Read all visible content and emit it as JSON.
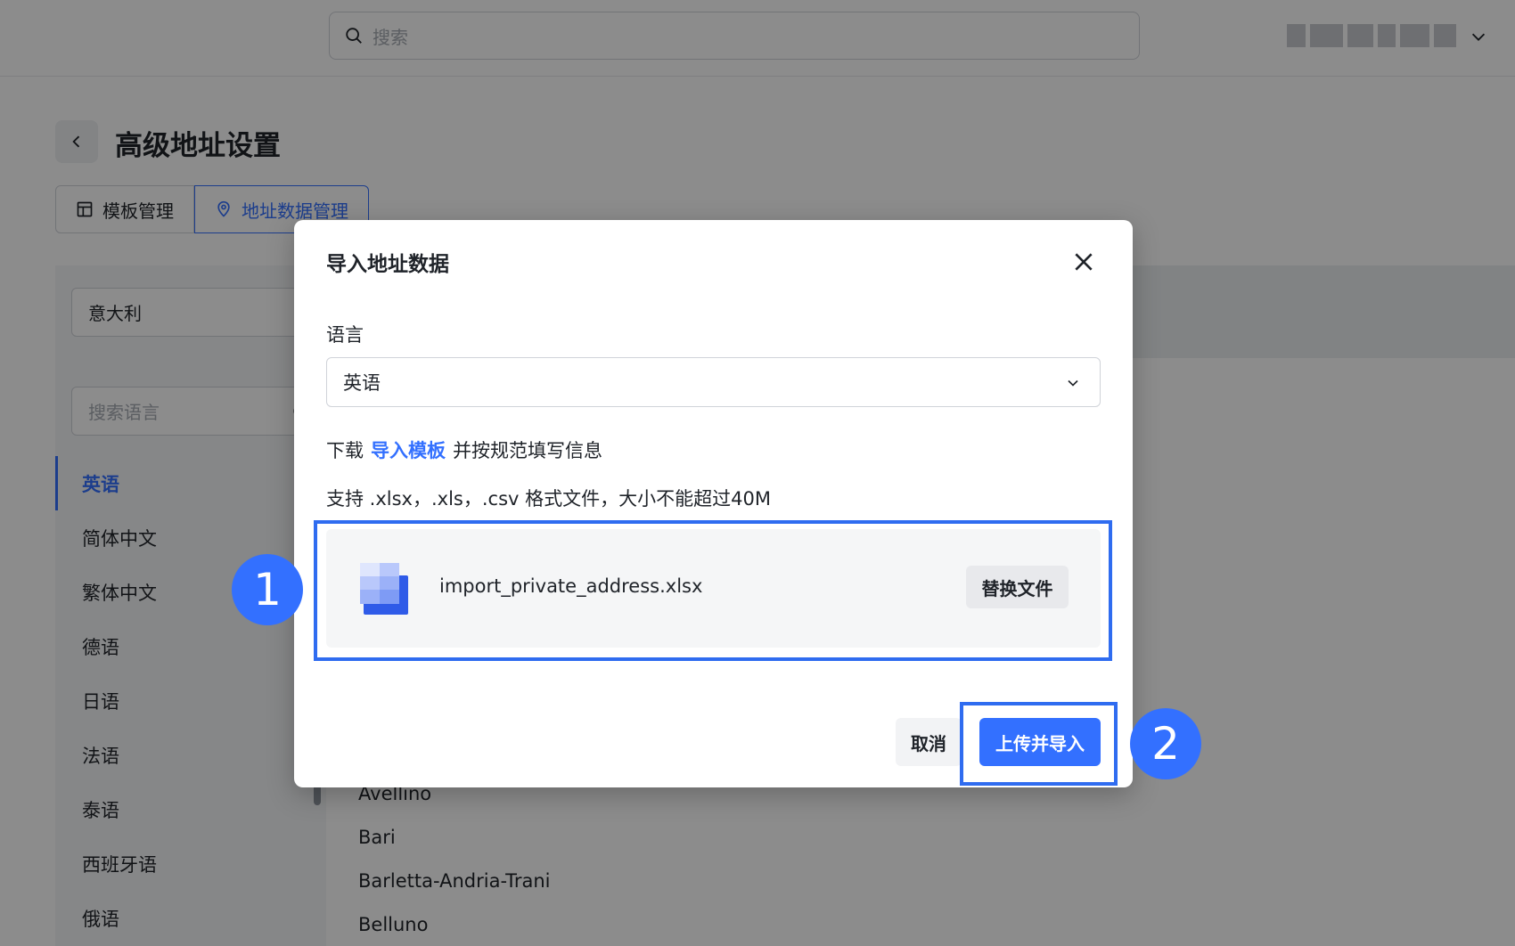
{
  "topbar": {
    "search_placeholder": "搜索"
  },
  "page": {
    "title": "高级地址设置",
    "tabs": [
      {
        "label": "模板管理",
        "icon": "layout-icon",
        "active": false
      },
      {
        "label": "地址数据管理",
        "icon": "location-pin-icon",
        "active": true
      }
    ],
    "country_value": "意大利",
    "language_search_placeholder": "搜索语言",
    "languages": [
      {
        "label": "英语",
        "active": true
      },
      {
        "label": "简体中文",
        "active": false
      },
      {
        "label": "繁体中文",
        "active": false
      },
      {
        "label": "德语",
        "active": false
      },
      {
        "label": "日语",
        "active": false
      },
      {
        "label": "法语",
        "active": false
      },
      {
        "label": "泰语",
        "active": false
      },
      {
        "label": "西班牙语",
        "active": false
      },
      {
        "label": "俄语",
        "active": false
      }
    ],
    "regions": [
      "Avellino",
      "Bari",
      "Barletta-Andria-Trani",
      "Belluno"
    ]
  },
  "modal": {
    "title": "导入地址数据",
    "language_label": "语言",
    "language_value": "英语",
    "download_prefix": "下载",
    "download_link": "导入模板",
    "download_suffix": "并按规范填写信息",
    "support_text": "支持 .xlsx，.xls，.csv 格式文件，大小不能超过40M",
    "file_name": "import_private_address.xlsx",
    "replace_button": "替换文件",
    "cancel_button": "取消",
    "submit_button": "上传并导入"
  },
  "annotations": {
    "step1": "1",
    "step2": "2",
    "highlight_color": "#2f6cf0"
  },
  "colors": {
    "primary": "#3370ff",
    "overlay": "rgba(0,0,0,0.45)"
  }
}
